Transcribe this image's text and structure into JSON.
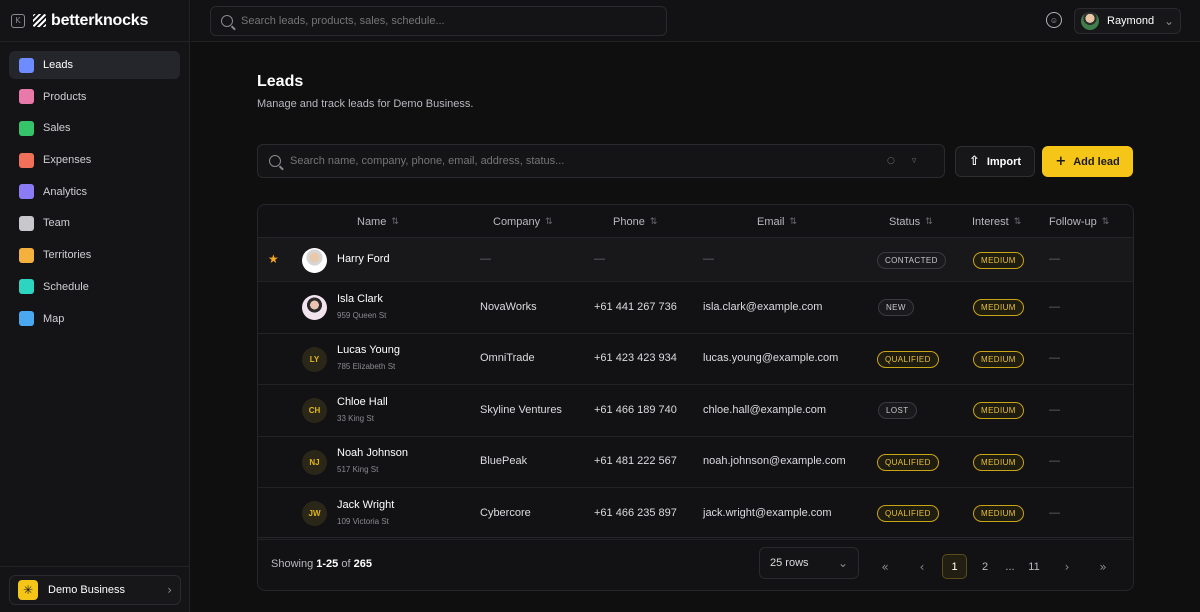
{
  "brand": {
    "name": "betterknocks"
  },
  "sidebar": {
    "items": [
      {
        "label": "Leads",
        "icon": "users-icon",
        "color": "#6d8cff",
        "active": true
      },
      {
        "label": "Products",
        "icon": "box-icon",
        "color": "#e879a8"
      },
      {
        "label": "Sales",
        "icon": "cart-icon",
        "color": "#36c46b"
      },
      {
        "label": "Expenses",
        "icon": "receipt-icon",
        "color": "#f0705a"
      },
      {
        "label": "Analytics",
        "icon": "chart-icon",
        "color": "#8b7cf6"
      },
      {
        "label": "Team",
        "icon": "team-icon",
        "color": "#c8c8cc"
      },
      {
        "label": "Territories",
        "icon": "pin-icon",
        "color": "#f5b13d"
      },
      {
        "label": "Schedule",
        "icon": "calendar-icon",
        "color": "#2dd4bf"
      },
      {
        "label": "Map",
        "icon": "map-icon",
        "color": "#4aa8f0"
      }
    ],
    "business": "Demo Business"
  },
  "topbar": {
    "search_placeholder": "Search leads, products, sales, schedule...",
    "user_name": "Raymond"
  },
  "page": {
    "title": "Leads",
    "subtitle": "Manage and track leads for Demo Business.",
    "search_placeholder": "Search name, company, phone, email, address, status...",
    "import_label": "Import",
    "add_label": "Add lead"
  },
  "table": {
    "columns": [
      "Name",
      "Company",
      "Phone",
      "Email",
      "Status",
      "Interest",
      "Follow-up"
    ],
    "rows": [
      {
        "name": "Harry Ford",
        "address": "",
        "company": "—",
        "phone": "—",
        "email": "—",
        "status": "CONTACTED",
        "interest": "MEDIUM",
        "followup": "—",
        "starred": true,
        "avatar": "photo1"
      },
      {
        "name": "Isla Clark",
        "address": "959 Queen St",
        "company": "NovaWorks",
        "phone": "+61 441 267 736",
        "email": "isla.clark@example.com",
        "status": "NEW",
        "interest": "MEDIUM",
        "followup": "—",
        "avatar": "photo2"
      },
      {
        "name": "Lucas Young",
        "address": "785 Elizabeth St",
        "company": "OmniTrade",
        "phone": "+61 423 423 934",
        "email": "lucas.young@example.com",
        "status": "QUALIFIED",
        "interest": "MEDIUM",
        "followup": "—",
        "initials": "LY"
      },
      {
        "name": "Chloe Hall",
        "address": "33 King St",
        "company": "Skyline Ventures",
        "phone": "+61 466 189 740",
        "email": "chloe.hall@example.com",
        "status": "LOST",
        "interest": "MEDIUM",
        "followup": "—",
        "initials": "CH"
      },
      {
        "name": "Noah Johnson",
        "address": "517 King St",
        "company": "BluePeak",
        "phone": "+61 481 222 567",
        "email": "noah.johnson@example.com",
        "status": "QUALIFIED",
        "interest": "MEDIUM",
        "followup": "—",
        "initials": "NJ"
      },
      {
        "name": "Jack Wright",
        "address": "109 Victoria St",
        "company": "Cybercore",
        "phone": "+61 466 235 897",
        "email": "jack.wright@example.com",
        "status": "QUALIFIED",
        "interest": "MEDIUM",
        "followup": "—",
        "initials": "JW"
      }
    ]
  },
  "footer": {
    "showing_prefix": "Showing ",
    "range": "1-25",
    "of": " of ",
    "total": "265",
    "rows_option": "25 rows",
    "pages": [
      "1",
      "2",
      "...",
      "11"
    ]
  }
}
